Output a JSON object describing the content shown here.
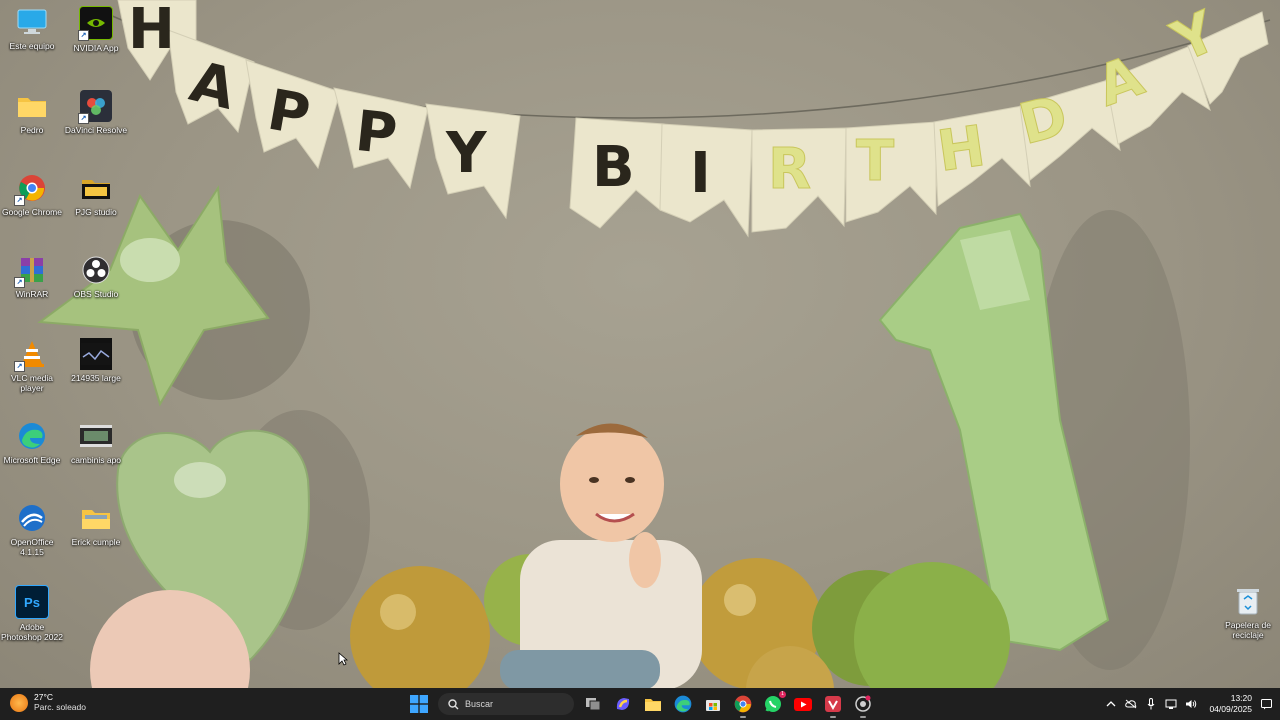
{
  "desktop": {
    "icons": [
      {
        "label": "Este equipo",
        "icon": "computer-icon"
      },
      {
        "label": "NVIDIA App",
        "icon": "nvidia-icon"
      },
      {
        "label": "Pedro",
        "icon": "folder-icon"
      },
      {
        "label": "DaVinci Resolve",
        "icon": "davinci-icon"
      },
      {
        "label": "Google Chrome",
        "icon": "chrome-icon"
      },
      {
        "label": "PJG studio",
        "icon": "folder-icon"
      },
      {
        "label": "WinRAR",
        "icon": "winrar-icon"
      },
      {
        "label": "OBS Studio",
        "icon": "obs-icon"
      },
      {
        "label": "VLC media player",
        "icon": "vlc-icon"
      },
      {
        "label": "214935 large",
        "icon": "video-thumbnail-icon"
      },
      {
        "label": "Microsoft Edge",
        "icon": "edge-icon"
      },
      {
        "label": "cambinis apo",
        "icon": "video-thumbnail-icon"
      },
      {
        "label": "OpenOffice 4.1.15",
        "icon": "openoffice-icon"
      },
      {
        "label": "Erick cumple",
        "icon": "folder-icon"
      },
      {
        "label": "Adobe Photoshop 2022",
        "icon": "photoshop-icon"
      },
      {
        "label": "Papelera de reciclaje",
        "icon": "recycle-bin-icon"
      }
    ]
  },
  "wallpaper": {
    "banner_letters": [
      "H",
      "A",
      "P",
      "P",
      "Y",
      "B",
      "I",
      "R",
      "T",
      "H",
      "D",
      "A",
      "Y"
    ],
    "balloon_number": "1"
  },
  "taskbar": {
    "weather": {
      "temp": "27°C",
      "desc": "Parc. soleado"
    },
    "search_placeholder": "Buscar",
    "apps": [
      {
        "name": "windows-start-icon"
      },
      {
        "name": "task-view-icon"
      },
      {
        "name": "copilot-icon"
      },
      {
        "name": "file-explorer-icon"
      },
      {
        "name": "edge-taskbar-icon"
      },
      {
        "name": "store-icon"
      },
      {
        "name": "chrome-taskbar-icon"
      },
      {
        "name": "whatsapp-icon",
        "badge": "1"
      },
      {
        "name": "youtube-icon"
      },
      {
        "name": "vivaldi-icon"
      },
      {
        "name": "davinci-taskbar-icon"
      }
    ],
    "clock": {
      "time": "13:20",
      "date": "04/09/2025"
    },
    "colors": {
      "bar": "#1f1f1f",
      "accent": "#0078d4"
    }
  }
}
